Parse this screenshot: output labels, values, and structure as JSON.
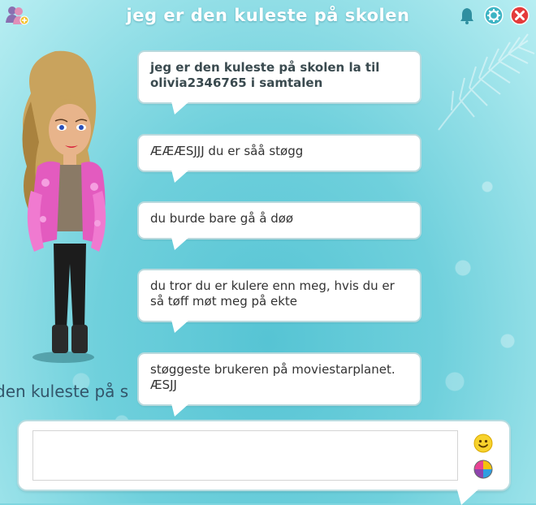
{
  "window": {
    "title": "jeg er den kuleste på skolen"
  },
  "header": {
    "icons": {
      "users": "users-add-icon",
      "bell": "bell-icon",
      "settings": "settings-icon",
      "close": "close-icon"
    }
  },
  "sidebar": {
    "participant_name_partial": "den kuleste på skolen"
  },
  "messages": [
    {
      "text": "jeg er den kuleste på skolen la til olivia2346765 i samtalen",
      "style": "system"
    },
    {
      "text": "ÆÆÆSJJJ du er såå støgg",
      "style": "normal"
    },
    {
      "text": "du burde bare gå å døø",
      "style": "normal"
    },
    {
      "text": "du tror du er kulere enn meg, hvis du er så tøff møt meg på ekte",
      "style": "normal"
    },
    {
      "text": "støggeste brukeren på moviestarplanet. ÆSJJ",
      "style": "normal"
    }
  ],
  "composer": {
    "value": "",
    "placeholder": "",
    "icons": {
      "emoji": "smiley-icon",
      "color": "color-wheel-icon"
    }
  },
  "colors": {
    "background": "#7fd6e0",
    "bubble": "#ffffff",
    "close_red": "#e43b3b",
    "settings_teal": "#3db4c4"
  }
}
